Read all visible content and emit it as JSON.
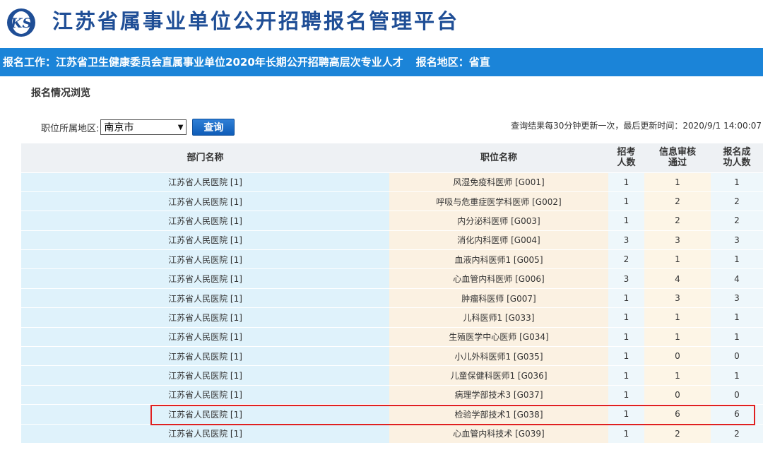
{
  "header": {
    "logo_text": "KS",
    "title": "江苏省属事业单位公开招聘报名管理平台"
  },
  "banner": {
    "job": "报名工作：江苏省卫生健康委员会直属事业单位2020年长期公开招聘高层次专业人才",
    "region": "报名地区：省直"
  },
  "section_title": "报名情况浏览",
  "filter": {
    "label": "职位所属地区:",
    "selected": "南京市",
    "query_label": "查询"
  },
  "update_info": "查询结果每30分钟更新一次，最后更新时间：2020/9/1 14:00:07",
  "table": {
    "headers": {
      "dept": "部门名称",
      "position": "职位名称",
      "quota": "招考\n人数",
      "approved": "信息审核\n通过",
      "success": "报名成\n功人数"
    },
    "rows": [
      {
        "dept": "江苏省人民医院 [1]",
        "position": "风湿免疫科医师 [G001]",
        "quota": "1",
        "approved": "1",
        "success": "1"
      },
      {
        "dept": "江苏省人民医院 [1]",
        "position": "呼吸与危重症医学科医师 [G002]",
        "quota": "1",
        "approved": "2",
        "success": "2"
      },
      {
        "dept": "江苏省人民医院 [1]",
        "position": "内分泌科医师 [G003]",
        "quota": "1",
        "approved": "2",
        "success": "2"
      },
      {
        "dept": "江苏省人民医院 [1]",
        "position": "消化内科医师 [G004]",
        "quota": "3",
        "approved": "3",
        "success": "3"
      },
      {
        "dept": "江苏省人民医院 [1]",
        "position": "血液内科医师1 [G005]",
        "quota": "2",
        "approved": "1",
        "success": "1"
      },
      {
        "dept": "江苏省人民医院 [1]",
        "position": "心血管内科医师 [G006]",
        "quota": "3",
        "approved": "4",
        "success": "4"
      },
      {
        "dept": "江苏省人民医院 [1]",
        "position": "肿瘤科医师 [G007]",
        "quota": "1",
        "approved": "3",
        "success": "3"
      },
      {
        "dept": "江苏省人民医院 [1]",
        "position": "儿科医师1 [G033]",
        "quota": "1",
        "approved": "1",
        "success": "1"
      },
      {
        "dept": "江苏省人民医院 [1]",
        "position": "生殖医学中心医师 [G034]",
        "quota": "1",
        "approved": "1",
        "success": "1"
      },
      {
        "dept": "江苏省人民医院 [1]",
        "position": "小儿外科医师1 [G035]",
        "quota": "1",
        "approved": "0",
        "success": "0"
      },
      {
        "dept": "江苏省人民医院 [1]",
        "position": "儿童保健科医师1 [G036]",
        "quota": "1",
        "approved": "1",
        "success": "1"
      },
      {
        "dept": "江苏省人民医院 [1]",
        "position": "病理学部技术3 [G037]",
        "quota": "1",
        "approved": "0",
        "success": "0"
      },
      {
        "dept": "江苏省人民医院 [1]",
        "position": "检验学部技术1 [G038]",
        "quota": "1",
        "approved": "6",
        "success": "6"
      },
      {
        "dept": "江苏省人民医院 [1]",
        "position": "心血管内科技术 [G039]",
        "quota": "1",
        "approved": "2",
        "success": "2"
      }
    ]
  }
}
